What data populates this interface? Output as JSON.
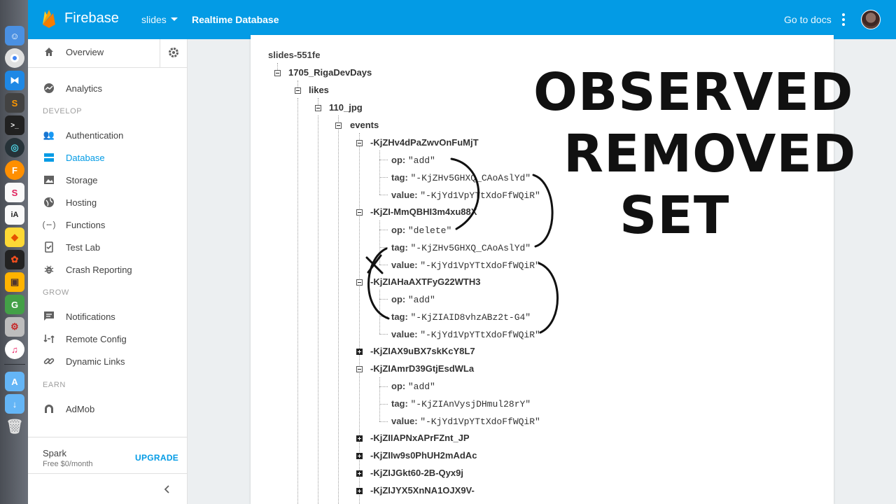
{
  "app": {
    "name": "Firebase",
    "project": "slides",
    "section": "Realtime Database",
    "docs_link": "Go to docs"
  },
  "sidebar": {
    "overview": "Overview",
    "analytics": "Analytics",
    "headers": {
      "develop": "DEVELOP",
      "grow": "GROW",
      "earn": "EARN"
    },
    "develop": [
      "Authentication",
      "Database",
      "Storage",
      "Hosting",
      "Functions",
      "Test Lab",
      "Crash Reporting"
    ],
    "grow": [
      "Notifications",
      "Remote Config",
      "Dynamic Links"
    ],
    "earn": [
      "AdMob"
    ],
    "active_item": "Database",
    "plan": {
      "name": "Spark",
      "price": "Free $0/month",
      "upgrade_label": "UPGRADE"
    }
  },
  "tree": {
    "root": "slides-551fe",
    "level1": "1705_RigaDevDays",
    "level2": "likes",
    "level3": "110_jpg",
    "level4": "events",
    "events": [
      {
        "key": "-KjZHv4dPaZwvOnFuMjT",
        "expanded": true,
        "op": "\"add\"",
        "tag": "\"-KjZHv5GHXQ_CAoAslYd\"",
        "value": "\"-KjYd1VpYTtXdoFfWQiR\""
      },
      {
        "key": "-KjZI-MmQBHI3m4xu88X",
        "expanded": true,
        "op": "\"delete\"",
        "tag": "\"-KjZHv5GHXQ_CAoAslYd\"",
        "value": "\"-KjYd1VpYTtXdoFfWQiR\""
      },
      {
        "key": "-KjZIAHaAXTFyG22WTH3",
        "expanded": true,
        "op": "\"add\"",
        "tag": "\"-KjZIAID8vhzABz2t-G4\"",
        "value": "\"-KjYd1VpYTtXdoFfWQiR\""
      },
      {
        "key": "-KjZIAX9uBX7skKcY8L7",
        "expanded": false
      },
      {
        "key": "-KjZIAmrD39GtjEsdWLa",
        "expanded": true,
        "op": "\"add\"",
        "tag": "\"-KjZIAnVysjDHmul28rY\"",
        "value": "\"-KjYd1VpYTtXdoFfWQiR\""
      },
      {
        "key": "-KjZIIAPNxAPrFZnt_JP",
        "expanded": false
      },
      {
        "key": "-KjZIIw9s0PhUH2mAdAc",
        "expanded": false
      },
      {
        "key": "-KjZIJGkt60-2B-Qyx9j",
        "expanded": false
      },
      {
        "key": "-KjZIJYX5XnNA1OJX9V-",
        "expanded": false
      }
    ],
    "field_labels": {
      "op": "op:",
      "tag": "tag:",
      "value": "value:"
    }
  },
  "annotation": {
    "lines": [
      "OBSERVED",
      "REMOVED",
      "SET"
    ]
  },
  "colors": {
    "topbar": "#039be5",
    "accent": "#039be5",
    "dock": "#5a5e66"
  }
}
